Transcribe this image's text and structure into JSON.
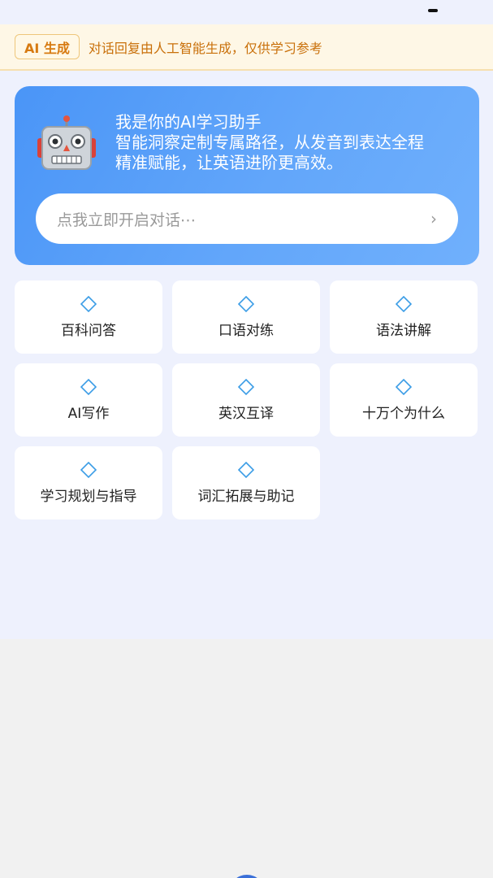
{
  "notice": {
    "badge": "AI 生成",
    "text": "对话回复由人工智能生成，仅供学习参考"
  },
  "hero": {
    "title": "我是你的AI学习助手",
    "line2": "智能洞察定制专属路径，从发音到表达全程",
    "line3": "精准赋能，让英语进阶更高效。",
    "icon": "robot-icon",
    "input_placeholder": "点我立即开启对话⋯",
    "arrow": "›"
  },
  "features": [
    {
      "label": "百科问答",
      "icon": "diamond-icon"
    },
    {
      "label": "口语对练",
      "icon": "diamond-icon"
    },
    {
      "label": "语法讲解",
      "icon": "diamond-icon"
    },
    {
      "label": "AI写作",
      "icon": "diamond-icon"
    },
    {
      "label": "英汉互译",
      "icon": "diamond-icon"
    },
    {
      "label": "十万个为什么",
      "icon": "diamond-icon"
    },
    {
      "label": "学习规划与指导",
      "icon": "diamond-icon"
    },
    {
      "label": "词汇拓展与助记",
      "icon": "diamond-icon"
    }
  ],
  "colors": {
    "accent": "#4a95f7",
    "notice_text": "#c9700a",
    "page_bg": "#eef1fd"
  }
}
